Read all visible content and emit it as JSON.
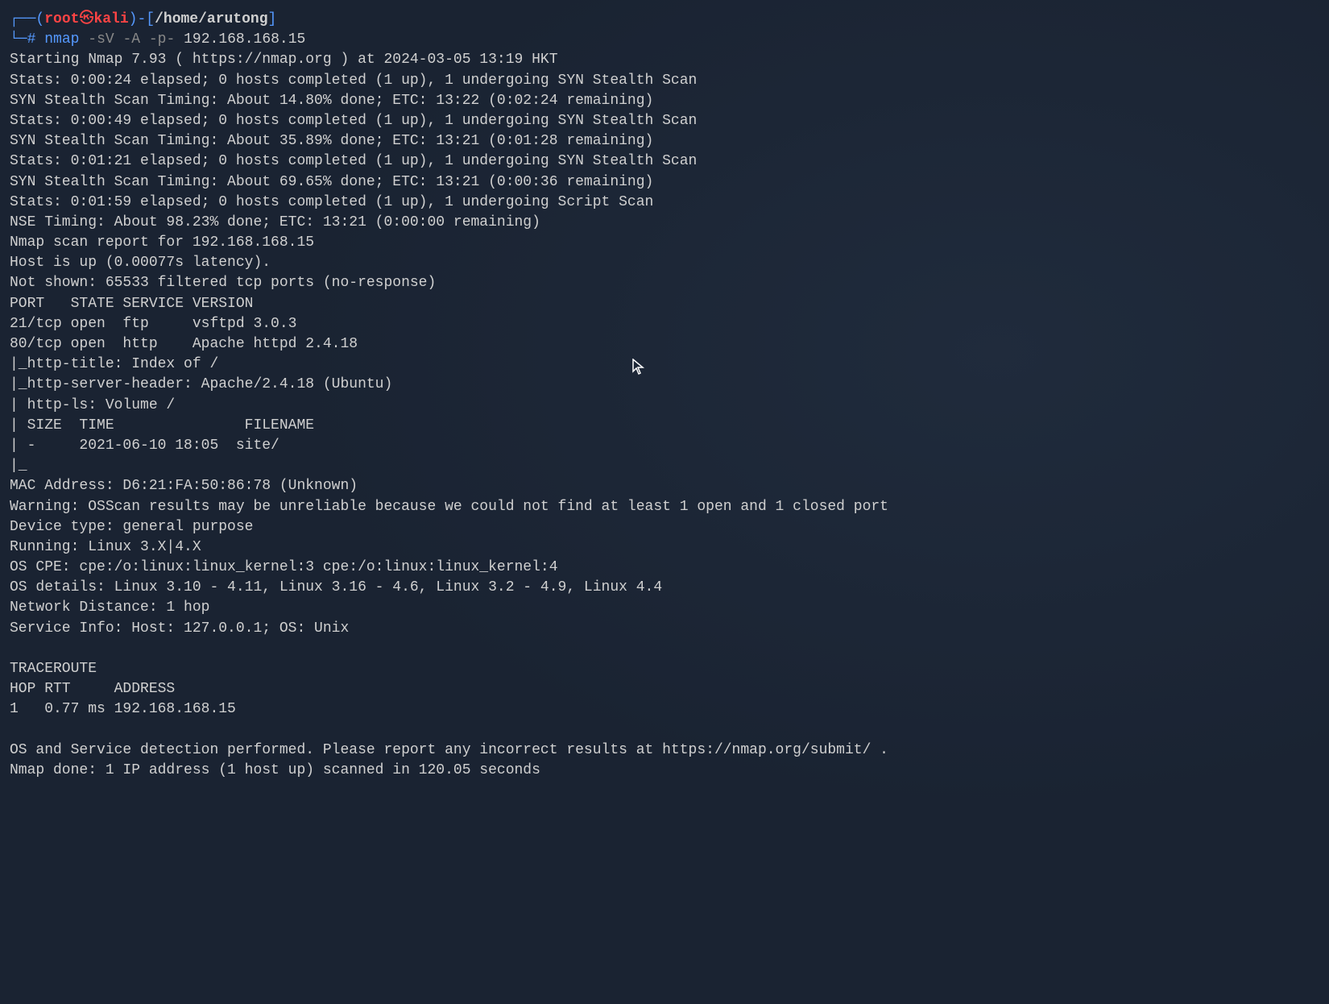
{
  "prompt": {
    "connector_top": "┌──",
    "connector_bottom": "└─",
    "paren_open": "(",
    "paren_close": ")",
    "user": "root",
    "at_icon": "㉿",
    "hostname": "kali",
    "separator": "-",
    "bracket_open": "[",
    "bracket_close": "]",
    "path": "/home/arutong",
    "hash": "#",
    "command": "nmap",
    "flags": "-sV -A -p-",
    "target": "192.168.168.15"
  },
  "output_lines": [
    "Starting Nmap 7.93 ( https://nmap.org ) at 2024-03-05 13:19 HKT",
    "Stats: 0:00:24 elapsed; 0 hosts completed (1 up), 1 undergoing SYN Stealth Scan",
    "SYN Stealth Scan Timing: About 14.80% done; ETC: 13:22 (0:02:24 remaining)",
    "Stats: 0:00:49 elapsed; 0 hosts completed (1 up), 1 undergoing SYN Stealth Scan",
    "SYN Stealth Scan Timing: About 35.89% done; ETC: 13:21 (0:01:28 remaining)",
    "Stats: 0:01:21 elapsed; 0 hosts completed (1 up), 1 undergoing SYN Stealth Scan",
    "SYN Stealth Scan Timing: About 69.65% done; ETC: 13:21 (0:00:36 remaining)",
    "Stats: 0:01:59 elapsed; 0 hosts completed (1 up), 1 undergoing Script Scan",
    "NSE Timing: About 98.23% done; ETC: 13:21 (0:00:00 remaining)",
    "Nmap scan report for 192.168.168.15",
    "Host is up (0.00077s latency).",
    "Not shown: 65533 filtered tcp ports (no-response)",
    "PORT   STATE SERVICE VERSION",
    "21/tcp open  ftp     vsftpd 3.0.3",
    "80/tcp open  http    Apache httpd 2.4.18",
    "|_http-title: Index of /",
    "|_http-server-header: Apache/2.4.18 (Ubuntu)",
    "| http-ls: Volume /",
    "| SIZE  TIME               FILENAME",
    "| -     2021-06-10 18:05  site/",
    "|_",
    "MAC Address: D6:21:FA:50:86:78 (Unknown)",
    "Warning: OSScan results may be unreliable because we could not find at least 1 open and 1 closed port",
    "Device type: general purpose",
    "Running: Linux 3.X|4.X",
    "OS CPE: cpe:/o:linux:linux_kernel:3 cpe:/o:linux:linux_kernel:4",
    "OS details: Linux 3.10 - 4.11, Linux 3.16 - 4.6, Linux 3.2 - 4.9, Linux 4.4",
    "Network Distance: 1 hop",
    "Service Info: Host: 127.0.0.1; OS: Unix",
    "",
    "TRACEROUTE",
    "HOP RTT     ADDRESS",
    "1   0.77 ms 192.168.168.15",
    "",
    "OS and Service detection performed. Please report any incorrect results at https://nmap.org/submit/ .",
    "Nmap done: 1 IP address (1 host up) scanned in 120.05 seconds"
  ]
}
